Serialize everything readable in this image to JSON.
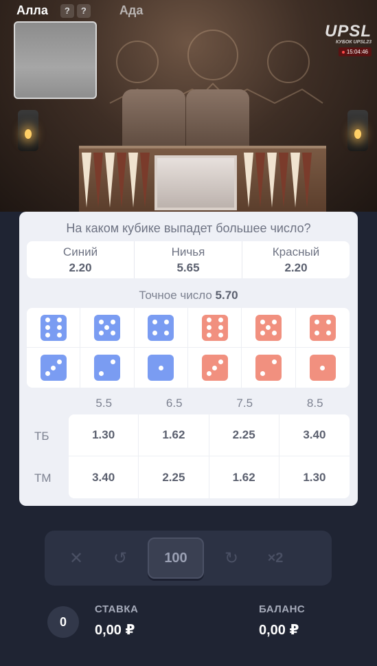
{
  "players": {
    "left": "Алла",
    "right": "Ада",
    "badges": [
      "?",
      "?"
    ]
  },
  "stream": {
    "logo": "UPSL",
    "subtitle": "КУБОК UPSL23",
    "time": "15:04:46"
  },
  "question": "На каком кубике выпадет большее число?",
  "outcomes": [
    {
      "label": "Синий",
      "odds": "2.20"
    },
    {
      "label": "Ничья",
      "odds": "5.65"
    },
    {
      "label": "Красный",
      "odds": "2.20"
    }
  ],
  "exact": {
    "label": "Точное число",
    "odds": "5.70"
  },
  "dice": {
    "colors": {
      "blue": "#7a9cf2",
      "red": "#f1907f"
    },
    "row1": [
      {
        "color": "blue",
        "value": 6
      },
      {
        "color": "blue",
        "value": 5
      },
      {
        "color": "blue",
        "value": 4
      },
      {
        "color": "red",
        "value": 6
      },
      {
        "color": "red",
        "value": 5
      },
      {
        "color": "red",
        "value": 4
      }
    ],
    "row2": [
      {
        "color": "blue",
        "value": 3
      },
      {
        "color": "blue",
        "value": 2
      },
      {
        "color": "blue",
        "value": 1
      },
      {
        "color": "red",
        "value": 3
      },
      {
        "color": "red",
        "value": 2
      },
      {
        "color": "red",
        "value": 1
      }
    ]
  },
  "totals": {
    "thresholds": [
      "5.5",
      "6.5",
      "7.5",
      "8.5"
    ],
    "rows": [
      {
        "label": "ТБ",
        "values": [
          "1.30",
          "1.62",
          "2.25",
          "3.40"
        ]
      },
      {
        "label": "ТМ",
        "values": [
          "3.40",
          "2.25",
          "1.62",
          "1.30"
        ]
      }
    ]
  },
  "controls": {
    "clear": "✕",
    "undo": "↺",
    "amount": "100",
    "redo": "↻",
    "double": "×2"
  },
  "footer": {
    "counter": "0",
    "stake_label": "СТАВКА",
    "stake_value": "0,00 ₽",
    "balance_label": "БАЛАНС",
    "balance_value": "0,00 ₽"
  }
}
